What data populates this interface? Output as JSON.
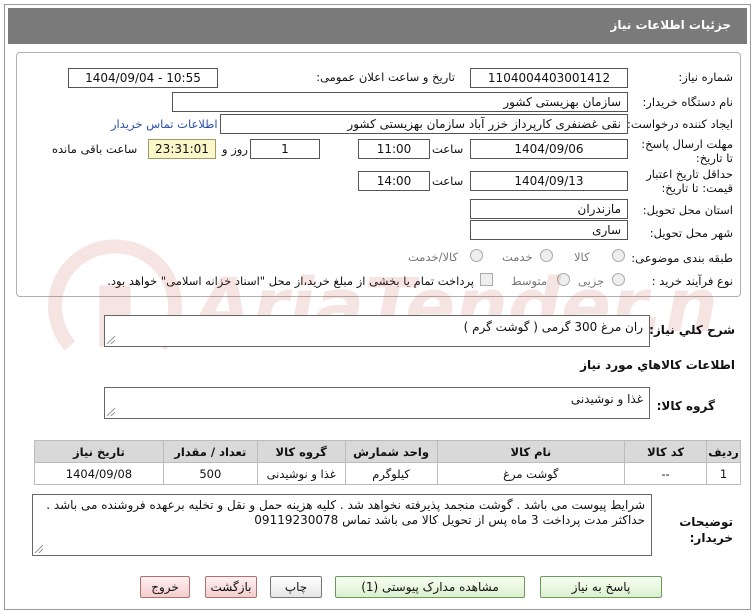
{
  "header": {
    "title": "جزئیات اطلاعات نیاز"
  },
  "form": {
    "need_number_label": "شماره نیاز:",
    "need_number": "1104004403001412",
    "announce_label": "تاریخ و ساعت اعلان عمومی:",
    "announce_value": "1404/09/04 - 10:55",
    "buyer_org_label": "نام دستگاه خریدار:",
    "buyer_org": "سازمان بهزیستی کشور",
    "creator_label": "ایجاد کننده درخواست:",
    "creator": "نقی غضنفری کارپرداز خزر آباد سازمان بهزیستی کشور",
    "contact_link": "اطلاعات تماس خریدار",
    "deadline_label": "مهلت ارسال پاسخ: تا تاریخ:",
    "deadline_date": "1404/09/06",
    "time_label": "ساعت",
    "deadline_time": "11:00",
    "days_value": "1",
    "days_label": "روز و",
    "remaining_time": "23:31:01",
    "remaining_label": "ساعت باقی مانده",
    "validity_label": "حداقل تاریخ اعتبار قیمت: تا تاریخ:",
    "validity_date": "1404/09/13",
    "validity_time": "14:00",
    "province_label": "استان محل تحویل:",
    "province": "مازندران",
    "city_label": "شهر محل تحویل:",
    "city": "ساری",
    "category_label": "طبقه بندی موضوعی:",
    "category_options": [
      "کالا",
      "خدمت",
      "کالا/خدمت"
    ],
    "process_label": "نوع فرآیند خرید :",
    "process_options": [
      "جزیی",
      "متوسط"
    ],
    "payment_note": "پرداخت تمام یا بخشی از مبلغ خرید،از محل \"اسناد خزانه اسلامی\" خواهد بود."
  },
  "summary": {
    "label": "شرح كلي نياز:",
    "value": "ران مرغ 300 گرمی ( گوشت گرم )"
  },
  "goods": {
    "section_title": "اطلاعات كالاهاي مورد نياز",
    "group_label": "گروه کالا:",
    "group_value": "غذا و نوشیدنی",
    "columns": [
      "ردیف",
      "کد کالا",
      "نام کالا",
      "واحد شمارش",
      "گروه کالا",
      "تعداد / مقدار",
      "تاریخ نیاز"
    ],
    "rows": [
      [
        "1",
        "--",
        "گوشت مرغ",
        "کیلوگرم",
        "غذا و نوشیدنی",
        "500",
        "1404/09/08"
      ]
    ]
  },
  "notes": {
    "label": "توضیحات خریدار:",
    "value": "شرایط پیوست می باشد . گوشت منجمد پذیرفته نخواهد شد . کلیه هزینه حمل و نقل و تخلیه  برعهده فروشنده می باشد . حداکثر مدت پرداخت 3 ماه پس از تحویل کالا می باشد تماس 09119230078"
  },
  "buttons": {
    "reply": "پاسخ به نیاز",
    "attachments": "مشاهده مدارک پیوستی (1)",
    "print": "چاپ",
    "back": "بازگشت",
    "exit": "خروج"
  },
  "watermark": {
    "text": "AriaTender.net"
  },
  "colors": {
    "title_bar": "#7a7a7a",
    "link": "#2a4fb0",
    "timer_bg": "#fbf7c9"
  }
}
